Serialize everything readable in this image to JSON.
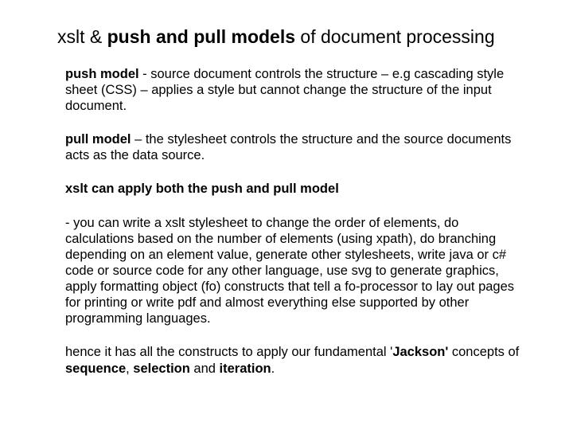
{
  "title": {
    "pre": "xslt & ",
    "bold": "push and pull models",
    "post": " of document processing"
  },
  "p1": {
    "lead": "push model",
    "rest": "  - source document controls the structure – e.g cascading style sheet (CSS) – applies a style but cannot change the structure of the input document."
  },
  "p2": {
    "lead": "pull model",
    "rest": " – the stylesheet controls the structure and the source documents acts as the data source."
  },
  "p3": {
    "bold": "xslt can apply both the push and pull model"
  },
  "p4": {
    "text": "- you can write a xslt stylesheet to change the order of elements, do calculations based on the number of elements (using xpath), do branching depending on an element value, generate other stylesheets, write java or c# code or source code for any other language, use svg to generate graphics, apply formatting object (fo) constructs that tell a fo-processor to lay out pages for printing or write pdf and almost everything else supported by other programming languages."
  },
  "p5": {
    "t1": "hence it has all the constructs to apply our fundamental '",
    "b1": "Jackson'",
    "t2": " concepts of ",
    "b2": "sequence",
    "t3": ", ",
    "b3": "selection",
    "t4": " and ",
    "b4": "iteration",
    "t5": "."
  }
}
